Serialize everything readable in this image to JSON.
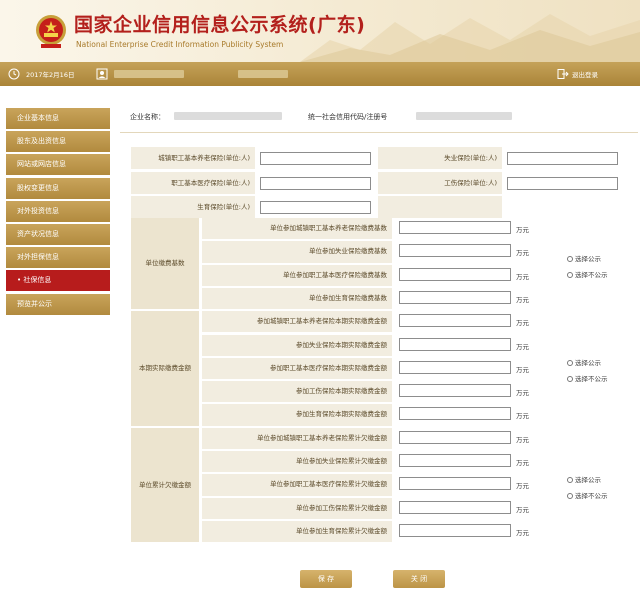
{
  "header": {
    "title_cn": "国家企业信用信息公示系统(广东)",
    "title_en": "National Enterprise Credit Information Publicity System"
  },
  "topbar": {
    "date": "2017年2月16日",
    "logout": "退出登录"
  },
  "sidebar": {
    "items": [
      {
        "label": "企业基本信息",
        "active": false
      },
      {
        "label": "股东及出资信息",
        "active": false
      },
      {
        "label": "网站或网店信息",
        "active": false
      },
      {
        "label": "股权变更信息",
        "active": false
      },
      {
        "label": "对外投资信息",
        "active": false
      },
      {
        "label": "资产状况信息",
        "active": false
      },
      {
        "label": "对外担保信息",
        "active": false
      },
      {
        "label": "社保信息",
        "active": true
      },
      {
        "label": "预览并公示",
        "active": false
      }
    ]
  },
  "company": {
    "name_label": "企业名称：",
    "code_label": "统一社会信用代码/注册号"
  },
  "counts": {
    "left": [
      {
        "label": "城镇职工基本养老保险(单位:人)"
      },
      {
        "label": "职工基本医疗保险(单位:人)"
      },
      {
        "label": "生育保险(单位:人)"
      }
    ],
    "right": [
      {
        "label": "失业保险(单位:人)"
      },
      {
        "label": "工伤保险(单位:人)"
      }
    ]
  },
  "groups": [
    {
      "label": "单位缴费基数",
      "rows": [
        {
          "label": "单位参加城镇职工基本养老保险缴费基数",
          "unit": "万元"
        },
        {
          "label": "单位参加失业保险缴费基数",
          "unit": "万元"
        },
        {
          "label": "单位参加职工基本医疗保险缴费基数",
          "unit": "万元"
        },
        {
          "label": "单位参加生育保险缴费基数",
          "unit": "万元"
        }
      ],
      "options": [
        "选择公示",
        "选择不公示"
      ]
    },
    {
      "label": "本期实际缴费金额",
      "rows": [
        {
          "label": "参加城镇职工基本养老保险本期实际缴费金额",
          "unit": "万元"
        },
        {
          "label": "参加失业保险本期实际缴费金额",
          "unit": "万元"
        },
        {
          "label": "参加职工基本医疗保险本期实际缴费金额",
          "unit": "万元"
        },
        {
          "label": "参加工伤保险本期实际缴费金额",
          "unit": "万元"
        },
        {
          "label": "参加生育保险本期实际缴费金额",
          "unit": "万元"
        }
      ],
      "options": [
        "选择公示",
        "选择不公示"
      ]
    },
    {
      "label": "单位累计欠缴金额",
      "rows": [
        {
          "label": "单位参加城镇职工基本养老保险累计欠缴金额",
          "unit": "万元"
        },
        {
          "label": "单位参加失业保险累计欠缴金额",
          "unit": "万元"
        },
        {
          "label": "单位参加职工基本医疗保险累计欠缴金额",
          "unit": "万元"
        },
        {
          "label": "单位参加工伤保险累计欠缴金额",
          "unit": "万元"
        },
        {
          "label": "单位参加生育保险累计欠缴金额",
          "unit": "万元"
        }
      ],
      "options": [
        "选择公示",
        "选择不公示"
      ]
    }
  ],
  "buttons": {
    "save": "保 存",
    "close": "关 闭"
  }
}
